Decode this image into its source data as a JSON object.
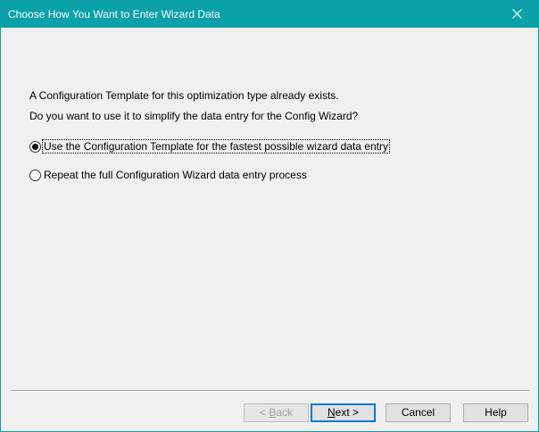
{
  "window": {
    "title": "Choose How You Want to Enter Wizard Data",
    "close_icon": "close-icon",
    "titlebar_color": "#0aa1a8"
  },
  "message": {
    "line1": "A Configuration Template for this optimization type already exists.",
    "line2": "Do you want to use it to simplify the data entry for the Config Wizard?"
  },
  "options": [
    {
      "label": "Use the Configuration Template for the fastest possible wizard data entry",
      "selected": true
    },
    {
      "label": "Repeat the full Configuration Wizard data entry process",
      "selected": false
    }
  ],
  "buttons": {
    "back": {
      "prefix": "< ",
      "mnemonic": "B",
      "rest": "ack",
      "enabled": false
    },
    "next": {
      "mnemonic": "N",
      "rest": "ext >",
      "default": true
    },
    "cancel": "Cancel",
    "help": "Help"
  }
}
